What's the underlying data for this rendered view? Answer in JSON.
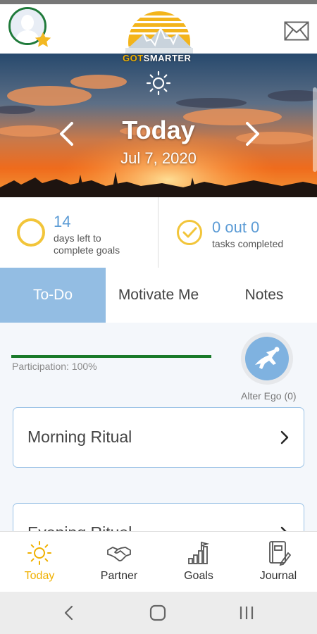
{
  "header": {
    "logo_prefix": "GOT",
    "logo_suffix": "SMARTER",
    "avatar_icon": "user-avatar-icon",
    "mail_icon": "mail-icon"
  },
  "hero": {
    "weather_icon": "sun-icon",
    "title": "Today",
    "date": "Jul 7, 2020"
  },
  "stats": {
    "days_left": {
      "value": "14",
      "label_line1": "days left to",
      "label_line2": "complete goals"
    },
    "tasks": {
      "value": "0 out 0",
      "label": "tasks completed"
    }
  },
  "tabs": [
    {
      "label": "To-Do",
      "active": true
    },
    {
      "label": "Motivate Me",
      "active": false
    },
    {
      "label": "Notes",
      "active": false
    }
  ],
  "participation": {
    "label": "Participation: 100%",
    "progress": 1.0
  },
  "alter_ego": {
    "label": "Alter Ego (0)"
  },
  "cards": [
    {
      "title": "Morning Ritual"
    },
    {
      "title": "Evening Ritual"
    }
  ],
  "bottom_nav": [
    {
      "label": "Today",
      "icon": "sun-icon",
      "active": true
    },
    {
      "label": "Partner",
      "icon": "handshake-icon",
      "active": false
    },
    {
      "label": "Goals",
      "icon": "goals-bar-chart-icon",
      "active": false
    },
    {
      "label": "Journal",
      "icon": "journal-icon",
      "active": false
    }
  ],
  "colors": {
    "accent": "#93bde3",
    "brand_gold": "#f0b000",
    "progress_green": "#1a7a2a",
    "stat_blue": "#5b9bd5"
  }
}
